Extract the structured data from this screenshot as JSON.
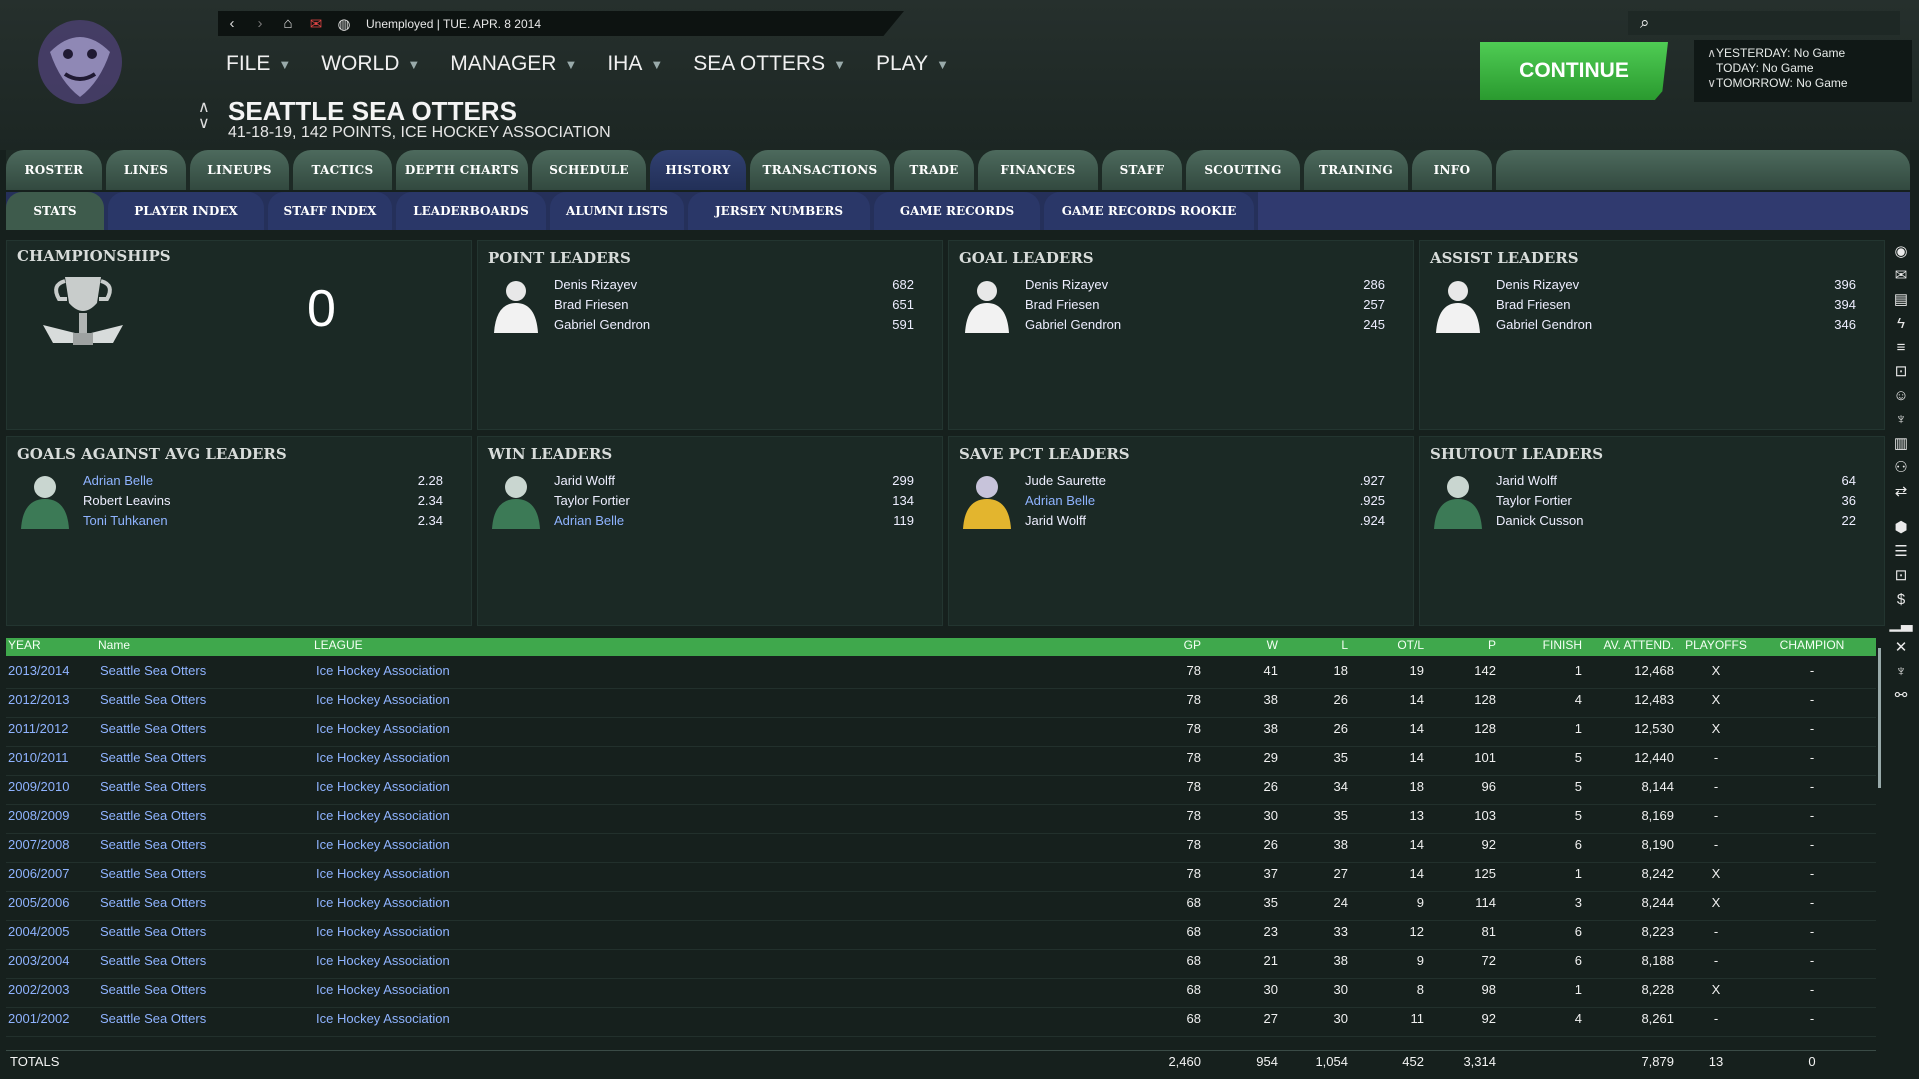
{
  "topbar": {
    "status": "Unemployed |  TUE. APR. 8 2014"
  },
  "menu": [
    {
      "label": "FILE"
    },
    {
      "label": "WORLD"
    },
    {
      "label": "MANAGER"
    },
    {
      "label": "IHA"
    },
    {
      "label": "SEA OTTERS"
    },
    {
      "label": "PLAY"
    }
  ],
  "team": {
    "name": "SEATTLE SEA OTTERS",
    "record": "41-18-19, 142 POINTS, ICE HOCKEY ASSOCIATION"
  },
  "continue_label": "CONTINUE",
  "schedule": {
    "yesterday": "YESTERDAY: No Game",
    "today": "TODAY: No Game",
    "tomorrow": "TOMORROW: No Game"
  },
  "tabs": [
    "ROSTER",
    "LINES",
    "LINEUPS",
    "TACTICS",
    "DEPTH CHARTS",
    "SCHEDULE",
    "HISTORY",
    "TRANSACTIONS",
    "TRADE",
    "FINANCES",
    "STAFF",
    "SCOUTING",
    "TRAINING",
    "INFO"
  ],
  "subtabs": [
    "STATS",
    "PLAYER INDEX",
    "STAFF INDEX",
    "LEADERBOARDS",
    "ALUMNI LISTS",
    "JERSEY NUMBERS",
    "GAME RECORDS",
    "GAME RECORDS ROOKIE"
  ],
  "championships": {
    "title": "CHAMPIONSHIPS",
    "count": "0"
  },
  "leaders": {
    "points": {
      "title": "POINT LEADERS",
      "rows": [
        {
          "name": "Denis Rizayev",
          "value": "682"
        },
        {
          "name": "Brad Friesen",
          "value": "651"
        },
        {
          "name": "Gabriel Gendron",
          "value": "591"
        }
      ]
    },
    "goals": {
      "title": "GOAL LEADERS",
      "rows": [
        {
          "name": "Denis Rizayev",
          "value": "286"
        },
        {
          "name": "Brad Friesen",
          "value": "257"
        },
        {
          "name": "Gabriel Gendron",
          "value": "245"
        }
      ]
    },
    "assists": {
      "title": "ASSIST LEADERS",
      "rows": [
        {
          "name": "Denis Rizayev",
          "value": "396"
        },
        {
          "name": "Brad Friesen",
          "value": "394"
        },
        {
          "name": "Gabriel Gendron",
          "value": "346"
        }
      ]
    },
    "gaa": {
      "title": "GOALS AGAINST AVG LEADERS",
      "rows": [
        {
          "name": "Adrian Belle",
          "value": "2.28"
        },
        {
          "name": "Robert Leavins",
          "value": "2.34"
        },
        {
          "name": "Toni Tuhkanen",
          "value": "2.34"
        }
      ]
    },
    "wins": {
      "title": "WIN LEADERS",
      "rows": [
        {
          "name": "Jarid Wolff",
          "value": "299"
        },
        {
          "name": "Taylor Fortier",
          "value": "134"
        },
        {
          "name": "Adrian Belle",
          "value": "119"
        }
      ]
    },
    "savepct": {
      "title": "SAVE PCT LEADERS",
      "rows": [
        {
          "name": "Jude Saurette",
          "value": ".927"
        },
        {
          "name": "Adrian Belle",
          "value": ".925"
        },
        {
          "name": "Jarid Wolff",
          "value": ".924"
        }
      ]
    },
    "shutouts": {
      "title": "SHUTOUT LEADERS",
      "rows": [
        {
          "name": "Jarid Wolff",
          "value": "64"
        },
        {
          "name": "Taylor Fortier",
          "value": "36"
        },
        {
          "name": "Danick Cusson",
          "value": "22"
        }
      ]
    }
  },
  "table": {
    "headers": [
      "YEAR",
      "Name",
      "LEAGUE",
      "GP",
      "W",
      "L",
      "OT/L",
      "P",
      "FINISH",
      "AV. ATTEND.",
      "PLAYOFFS",
      "CHAMPION"
    ],
    "rows": [
      [
        "2013/2014",
        "Seattle Sea Otters",
        "Ice Hockey Association",
        "78",
        "41",
        "18",
        "19",
        "142",
        "1",
        "12,468",
        "X",
        "-"
      ],
      [
        "2012/2013",
        "Seattle Sea Otters",
        "Ice Hockey Association",
        "78",
        "38",
        "26",
        "14",
        "128",
        "4",
        "12,483",
        "X",
        "-"
      ],
      [
        "2011/2012",
        "Seattle Sea Otters",
        "Ice Hockey Association",
        "78",
        "38",
        "26",
        "14",
        "128",
        "1",
        "12,530",
        "X",
        "-"
      ],
      [
        "2010/2011",
        "Seattle Sea Otters",
        "Ice Hockey Association",
        "78",
        "29",
        "35",
        "14",
        "101",
        "5",
        "12,440",
        "-",
        "-"
      ],
      [
        "2009/2010",
        "Seattle Sea Otters",
        "Ice Hockey Association",
        "78",
        "26",
        "34",
        "18",
        "96",
        "5",
        "8,144",
        "-",
        "-"
      ],
      [
        "2008/2009",
        "Seattle Sea Otters",
        "Ice Hockey Association",
        "78",
        "30",
        "35",
        "13",
        "103",
        "5",
        "8,169",
        "-",
        "-"
      ],
      [
        "2007/2008",
        "Seattle Sea Otters",
        "Ice Hockey Association",
        "78",
        "26",
        "38",
        "14",
        "92",
        "6",
        "8,190",
        "-",
        "-"
      ],
      [
        "2006/2007",
        "Seattle Sea Otters",
        "Ice Hockey Association",
        "78",
        "37",
        "27",
        "14",
        "125",
        "1",
        "8,242",
        "X",
        "-"
      ],
      [
        "2005/2006",
        "Seattle Sea Otters",
        "Ice Hockey Association",
        "68",
        "35",
        "24",
        "9",
        "114",
        "3",
        "8,244",
        "X",
        "-"
      ],
      [
        "2004/2005",
        "Seattle Sea Otters",
        "Ice Hockey Association",
        "68",
        "23",
        "33",
        "12",
        "81",
        "6",
        "8,223",
        "-",
        "-"
      ],
      [
        "2003/2004",
        "Seattle Sea Otters",
        "Ice Hockey Association",
        "68",
        "21",
        "38",
        "9",
        "72",
        "6",
        "8,188",
        "-",
        "-"
      ],
      [
        "2002/2003",
        "Seattle Sea Otters",
        "Ice Hockey Association",
        "68",
        "30",
        "30",
        "8",
        "98",
        "1",
        "8,228",
        "X",
        "-"
      ],
      [
        "2001/2002",
        "Seattle Sea Otters",
        "Ice Hockey Association",
        "68",
        "27",
        "30",
        "11",
        "92",
        "4",
        "8,261",
        "-",
        "-"
      ]
    ],
    "totals": {
      "label": "TOTALS",
      "gp": "2,460",
      "w": "954",
      "l": "1,054",
      "otl": "452",
      "p": "3,314",
      "attend": "7,879",
      "playoffs": "13",
      "champion": "0"
    }
  },
  "icons": {
    "search": "search-icon",
    "back": "back-arrow-icon",
    "forward": "forward-arrow-icon",
    "home": "home-icon",
    "mail": "mail-icon",
    "globe": "globe-icon"
  },
  "colors": {
    "accent_green": "#3fa84c",
    "continue_green": "#3fbf45",
    "link_blue": "#8fb3ff",
    "tab_active": "#2b3a68"
  }
}
